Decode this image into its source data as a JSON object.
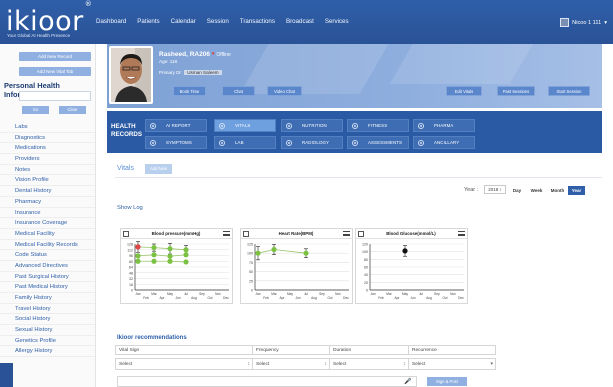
{
  "brand": {
    "logo": "ikioor",
    "registered": "®",
    "tagline": "Your Global AI Health Presence"
  },
  "nav": [
    "Dashboard",
    "Patients",
    "Calendar",
    "Session",
    "Transactions",
    "Broadcast",
    "Services"
  ],
  "user": {
    "name": "Nicoo 1 111",
    "menu_icon": "chevron-down-icon"
  },
  "sidebar": {
    "buttons": [
      "Add New Record",
      "Add New Vital Tab"
    ],
    "title": "Personal Health Information",
    "search_value": "",
    "go_label": "Go",
    "clear_label": "Clear",
    "items": [
      "Labs",
      "Diagnostics",
      "Medications",
      "Providers",
      "Notes",
      "Vision Profile",
      "Dental History",
      "Pharmacy",
      "Insurance",
      "Insurance Coverage",
      "Medical Facility",
      "Medical Facility Records",
      "Code Status",
      "Advanced Directives",
      "Past Surgical History",
      "Past Medical History",
      "Family History",
      "Travel History",
      "Social History",
      "Sexual History",
      "Genetics Profile",
      "Allergy History"
    ]
  },
  "patient": {
    "name": "Rasheed, RA206",
    "status_dot": "•",
    "status": "Offline",
    "age": "Age: 118",
    "primary_dr_label": "Primary Dr:",
    "primary_dr_value": "Usman Saleem",
    "left_buttons": [
      "Book Time",
      "Chat",
      "Video Chat"
    ],
    "right_buttons": [
      "Edit Vitals",
      "Past Sessions",
      "Start Session"
    ]
  },
  "health_records": {
    "title_line1": "HEALTH",
    "title_line2": "RECORDS",
    "tiles_row1": [
      "AI REPORT",
      "VITALS",
      "NUTRITION",
      "FITNESS",
      "PHARMA"
    ],
    "tiles_row2": [
      "SYMPTOMS",
      "LAB",
      "RADIOLOGY",
      "ASSESSMENTS",
      "ANCILLARY"
    ],
    "selected": "VITALS",
    "colors": {
      "panel": "#2a5aa3",
      "tile": "#3e6db4",
      "selected": "#6ea0e0"
    }
  },
  "vitals": {
    "title": "Vitals",
    "add_new": "Add New",
    "year_label": "Year :",
    "year_value": "2018 ↕",
    "ranges": [
      "Day",
      "Week",
      "Month",
      "Year"
    ],
    "range_selected": "Year",
    "show_log": "Show Log"
  },
  "chart_data": [
    {
      "type": "scatter",
      "title": "Blood pressure(mmHg)",
      "x": [
        "Jan",
        "Feb",
        "Mar",
        "Apr",
        "May",
        "Jun",
        "Jul",
        "Aug",
        "Sep",
        "Oct",
        "Nov",
        "Dec"
      ],
      "yticks": [
        0,
        16,
        32,
        48,
        64,
        80,
        96,
        112,
        128
      ],
      "ylim": [
        0,
        128
      ],
      "series": [
        {
          "values": [
            120,
            null,
            118,
            null,
            115,
            null,
            112,
            null,
            null,
            null,
            null,
            null
          ],
          "errors": [
            15,
            null,
            10,
            null,
            15,
            null,
            12,
            null,
            null,
            null,
            null,
            null
          ]
        },
        {
          "values": [
            95,
            null,
            98,
            null,
            94,
            null,
            98,
            null,
            null,
            null,
            null,
            null
          ]
        },
        {
          "values": [
            80,
            null,
            80,
            null,
            80,
            null,
            78,
            null,
            null,
            null,
            null,
            null
          ]
        }
      ],
      "highlight_color": "#e04444",
      "point_color": "#7cc242"
    },
    {
      "type": "scatter",
      "title": "Heart Rate(BPM)",
      "x": [
        "Jan",
        "Feb",
        "Mar",
        "Apr",
        "May",
        "Jun",
        "Jul",
        "Aug",
        "Sep",
        "Oct",
        "Nov",
        "Dec"
      ],
      "yticks": [
        0,
        25,
        50,
        75,
        100,
        125
      ],
      "ylim": [
        0,
        125
      ],
      "series": [
        {
          "values": [
            100,
            null,
            110,
            null,
            null,
            null,
            100,
            null,
            null,
            null,
            null,
            null
          ],
          "errors": [
            18,
            null,
            14,
            null,
            null,
            null,
            12,
            null,
            null,
            null,
            null,
            null
          ]
        }
      ],
      "point_color": "#7cc242"
    },
    {
      "type": "scatter",
      "title": "Blood Glucose(mmol/L)",
      "x": [
        "Jan",
        "Feb",
        "Mar",
        "Apr",
        "May",
        "Jun",
        "Jul",
        "Aug",
        "Sep",
        "Oct",
        "Nov",
        "Dec"
      ],
      "yticks": [
        0,
        20,
        40,
        60,
        80,
        100,
        120
      ],
      "ylim": [
        0,
        120
      ],
      "series": [
        {
          "values": [
            null,
            null,
            null,
            null,
            102,
            null,
            null,
            null,
            null,
            null,
            null,
            null
          ],
          "errors": [
            null,
            null,
            null,
            null,
            14,
            null,
            null,
            null,
            null,
            null,
            null,
            null
          ]
        }
      ],
      "point_color": "#111111"
    }
  ],
  "recommendations": {
    "title": "Ikioor recommendations",
    "headers": [
      "Vital Sign",
      "Frequency",
      "Duration",
      "Recurrence"
    ],
    "selects": [
      "Select",
      "Select",
      "Select",
      "Select"
    ],
    "sign_post": "Sign & Post"
  }
}
